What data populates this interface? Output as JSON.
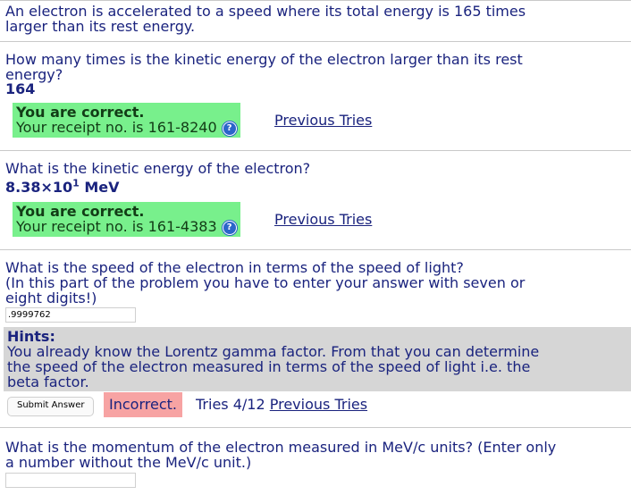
{
  "intro": {
    "line1": "An electron is accelerated to a speed where its total energy is 165 times",
    "line2": "larger than its rest energy."
  },
  "q1": {
    "line1": "How many times is the kinetic energy of the electron larger than its rest",
    "line2": "energy?",
    "answer": "164",
    "status": "You are correct.",
    "receipt": "Your receipt no. is 161-8240",
    "previous_tries": "Previous Tries"
  },
  "q2": {
    "prompt": "What is the kinetic energy of the electron?",
    "answer_mantissa": "8.38×10",
    "answer_exp": "1",
    "answer_unit": " MeV",
    "status": "You are correct.",
    "receipt": "Your receipt no. is 161-4383",
    "previous_tries": "Previous Tries"
  },
  "q3": {
    "line1": "What is the speed of the electron in terms of the speed of light?",
    "line2": "(In this part of the problem you have to enter your answer with seven or",
    "line3": "eight digits!)",
    "input_value": ".9999762",
    "hints_title": "Hints:",
    "hints_line1": "You already know the Lorentz gamma factor. From that you can determine",
    "hints_line2": "the speed of the electron measured in terms of the speed of light i.e. the",
    "hints_line3": "beta factor.",
    "submit_label": "Submit Answer",
    "status": "Incorrect.",
    "tries": "Tries 4/12",
    "previous_tries": "Previous Tries"
  },
  "q4": {
    "line1": "What is the momentum of the electron measured in MeV/c units? (Enter only",
    "line2": "a number without the MeV/c unit.)",
    "input_value": ""
  },
  "colors": {
    "text": "#1a237e",
    "correct_bg": "#78f08c",
    "incorrect_bg": "#f7a3a3",
    "hints_bg": "#d6d6d6",
    "help_icon": "#2b65c9"
  },
  "icons": {
    "help": "question-mark-icon"
  }
}
